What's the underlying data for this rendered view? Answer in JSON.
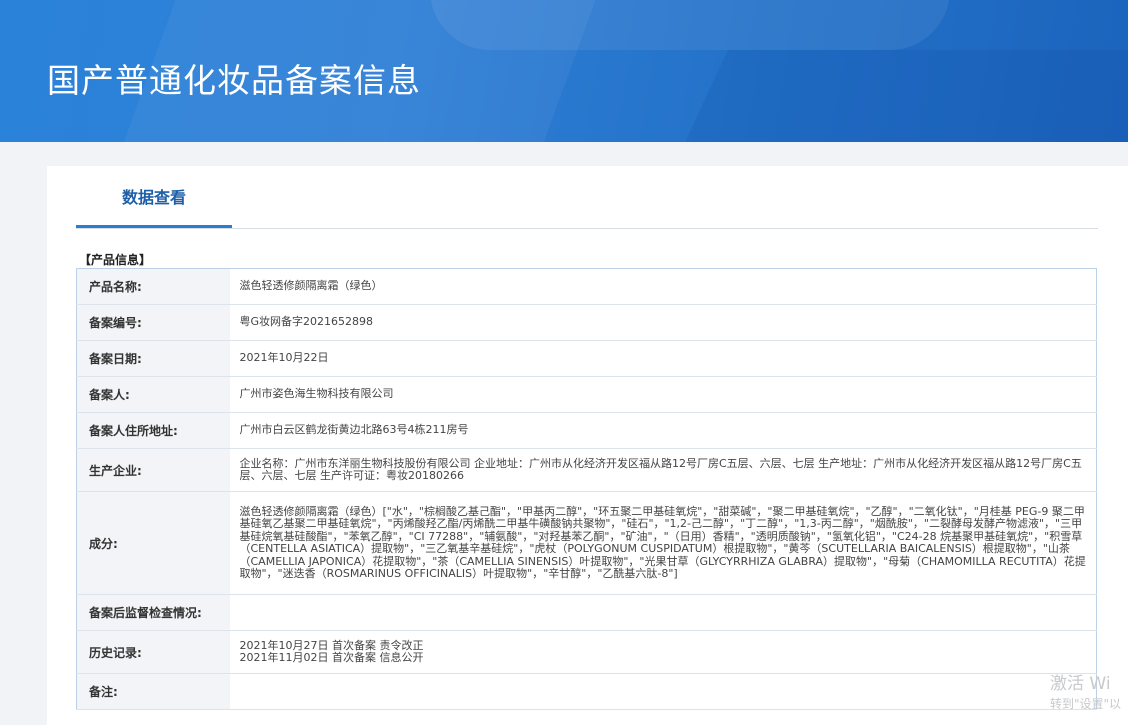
{
  "page": {
    "title": "国产普通化妆品备案信息"
  },
  "tab": {
    "label": "数据查看"
  },
  "section": {
    "title": "【产品信息】"
  },
  "rows": [
    {
      "key": "产品名称:",
      "value": "滋色轻透修颜隔离霜（绿色）"
    },
    {
      "key": "备案编号:",
      "value": "粤G妆网备字2021652898"
    },
    {
      "key": "备案日期:",
      "value": "2021年10月22日"
    },
    {
      "key": "备案人:",
      "value": "广州市姿色海生物科技有限公司"
    },
    {
      "key": "备案人住所地址:",
      "value": "广州市白云区鹤龙街黄边北路63号4栋211房号"
    },
    {
      "key": "生产企业:",
      "value": "企业名称：广州市东洋丽生物科技股份有限公司 企业地址：广州市从化经济开发区福从路12号厂房C五层、六层、七层 生产地址：广州市从化经济开发区福从路12号厂房C五层、六层、七层 生产许可证：粤妆20180266"
    },
    {
      "key": "成分:",
      "value": "滋色轻透修颜隔离霜（绿色）[\"水\"，\"棕榈酸乙基己酯\"，\"甲基丙二醇\"，\"环五聚二甲基硅氧烷\"，\"甜菜碱\"，\"聚二甲基硅氧烷\"，\"乙醇\"，\"二氧化钛\"，\"月桂基 PEG-9 聚二甲基硅氧乙基聚二甲基硅氧烷\"，\"丙烯酸羟乙酯/丙烯酰二甲基牛磺酸钠共聚物\"，\"硅石\"，\"1,2-己二醇\"，\"丁二醇\"，\"1,3-丙二醇\"，\"烟酰胺\"，\"二裂酵母发酵产物滤液\"，\"三甲基硅烷氧基硅酸酯\"，\"苯氧乙醇\"，\"CI 77288\"，\"辅氨酸\"，\"对羟基苯乙酮\"，\"矿油\"，\"（日用）香精\"，\"透明质酸钠\"，\"氢氧化铝\"，\"C24-28 烷基聚甲基硅氧烷\"，\"积雪草（CENTELLA ASIATICA）提取物\"，\"三乙氧基辛基硅烷\"，\"虎杖（POLYGONUM CUSPIDATUM）根提取物\"，\"黄芩（SCUTELLARIA BAICALENSIS）根提取物\"，\"山茶（CAMELLIA JAPONICA）花提取物\"，\"茶（CAMELLIA SINENSIS）叶提取物\"，\"光果甘草（GLYCYRRHIZA GLABRA）提取物\"，\"母菊（CHAMOMILLA RECUTITA）花提取物\"，\"迷迭香（ROSMARINUS OFFICINALIS）叶提取物\"，\"辛甘醇\"，\"乙酰基六肽-8\"]"
    },
    {
      "key": "备案后监督检查情况:",
      "value": ""
    },
    {
      "key": "历史记录:",
      "value": "2021年10月27日 首次备案 责令改正\n2021年11月02日 首次备案 信息公开"
    },
    {
      "key": "备注:",
      "value": ""
    }
  ],
  "watermark": {
    "line1": "激活 Wi",
    "line2": "转到\"设置\"以"
  }
}
